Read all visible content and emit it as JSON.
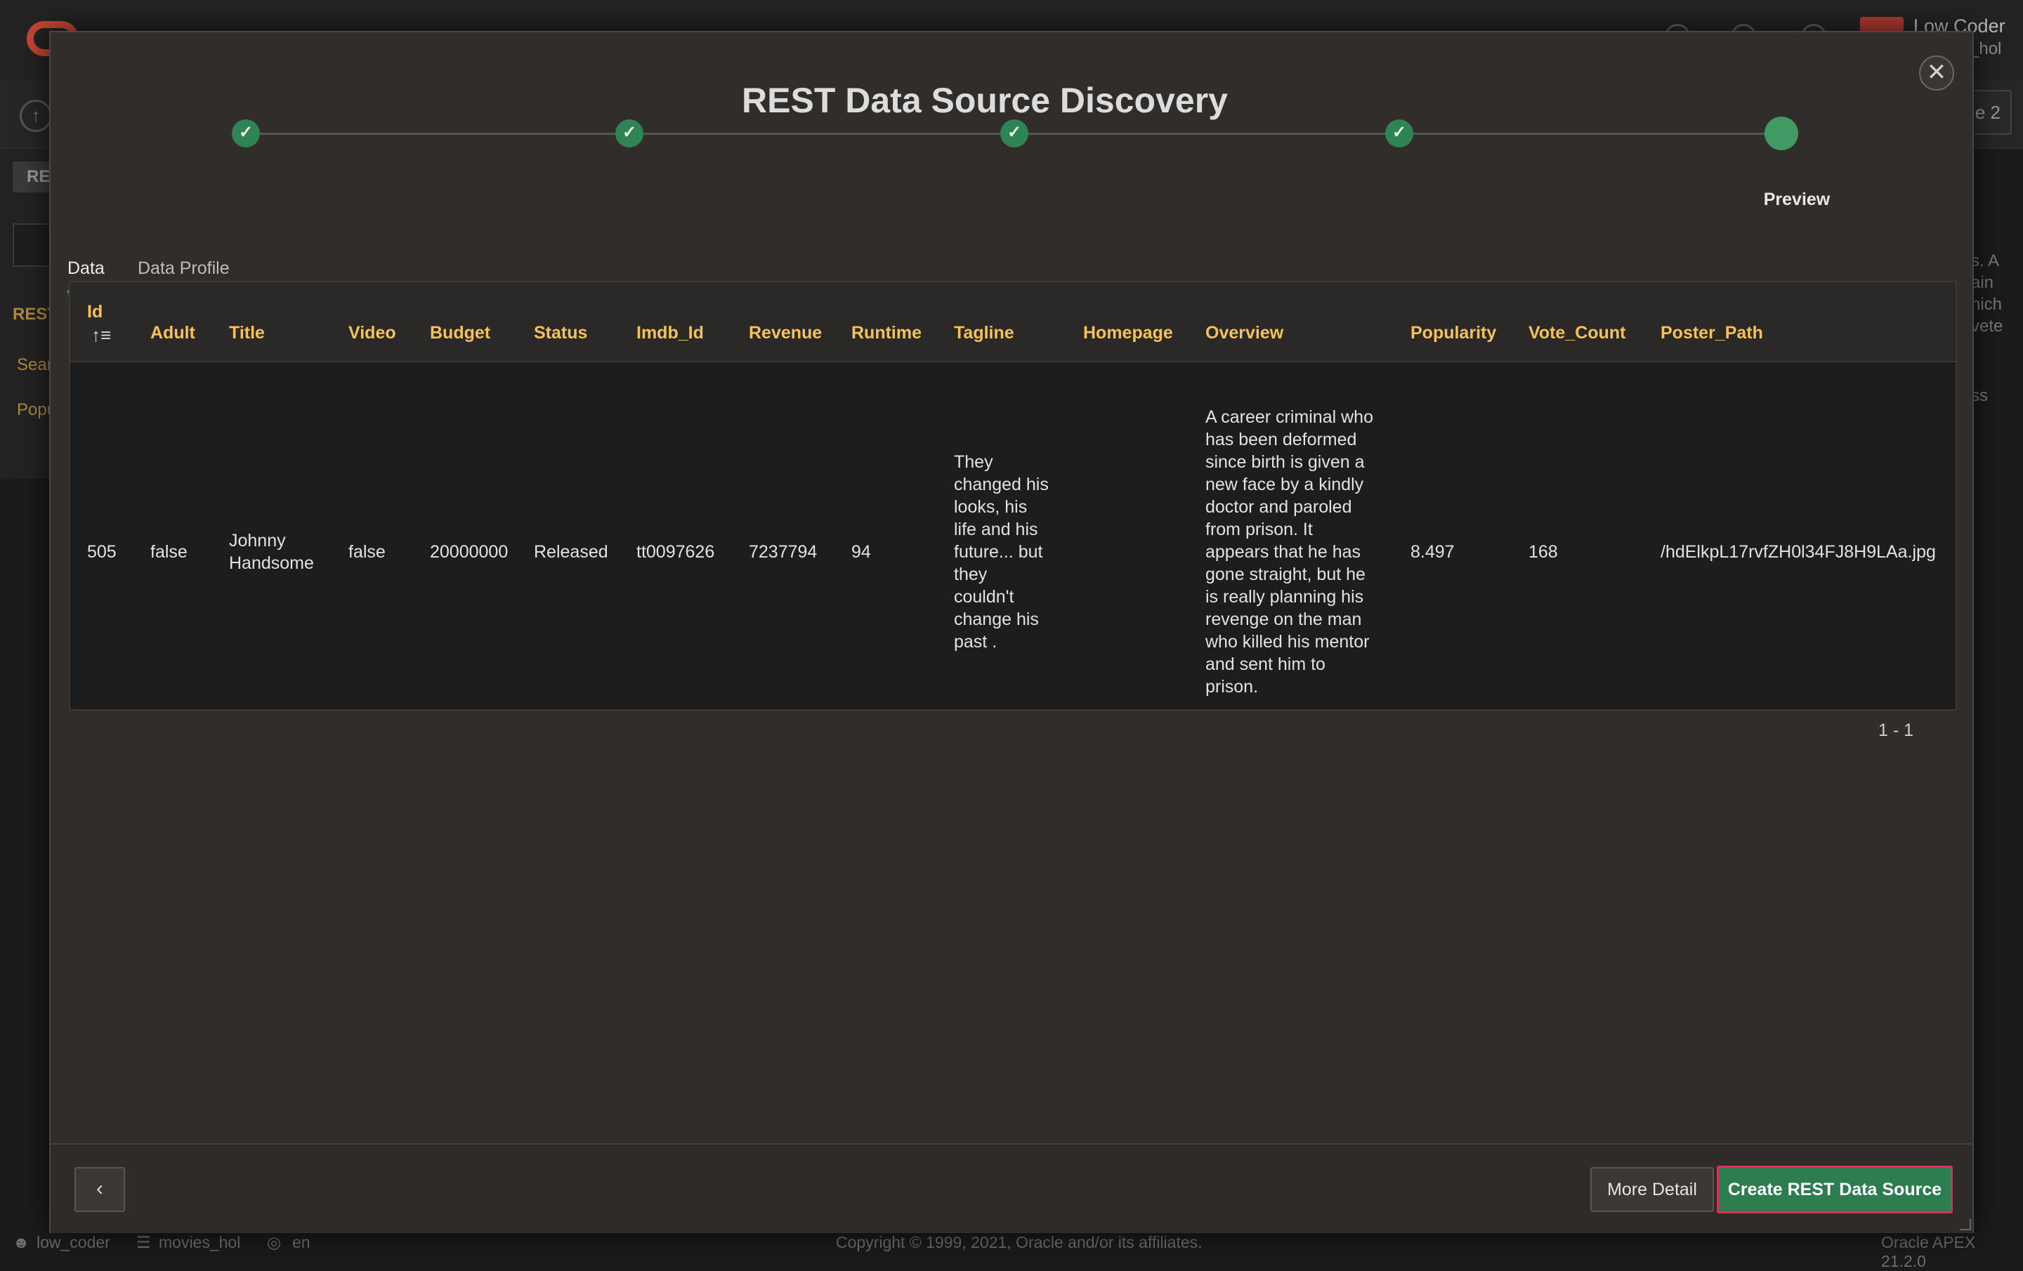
{
  "background": {
    "user_name": "Low Coder",
    "user_workspace": "_hol",
    "page_button": "e 2",
    "left_tab": "RE",
    "rest_label": "REST",
    "links": [
      "Sear",
      "Popu"
    ],
    "right_text": [
      "s. A",
      "ain",
      "hich",
      "vete",
      "ss"
    ],
    "footer": {
      "user": "low_coder",
      "schema": "movies_hol",
      "language": "en",
      "copyright": "Copyright © 1999, 2021, Oracle and/or its affiliates.",
      "version": "Oracle APEX 21.2.0"
    }
  },
  "modal": {
    "title": "REST Data Source Discovery",
    "close_glyph": "✕",
    "steps": [
      {
        "glyph": "✓"
      },
      {
        "glyph": "✓"
      },
      {
        "glyph": "✓"
      },
      {
        "glyph": "✓"
      },
      {
        "glyph": ""
      }
    ],
    "current_step_label": "Preview",
    "tabs": [
      "Data",
      "Data Profile"
    ],
    "active_tab": "Data",
    "columns": [
      "Id",
      "Adult",
      "Title",
      "Video",
      "Budget",
      "Status",
      "Imdb_Id",
      "Revenue",
      "Runtime",
      "Tagline",
      "Homepage",
      "Overview",
      "Popularity",
      "Vote_Count",
      "Poster_Path"
    ],
    "sort_glyph": "↑≡",
    "row": {
      "id": "505",
      "adult": "false",
      "title_lines": [
        "Johnny",
        "Handsome"
      ],
      "video": "false",
      "budget": "20000000",
      "status": "Released",
      "imdb_id": "tt0097626",
      "revenue": "7237794",
      "runtime": "94",
      "tagline_lines": [
        "They",
        "changed his",
        "looks, his",
        "life and his",
        "future... but",
        "they",
        "couldn't",
        "change his",
        "past ."
      ],
      "homepage": "",
      "overview_lines": [
        "A career criminal who",
        "has been deformed",
        "since birth is given a",
        "new face by a kindly",
        "doctor and paroled",
        "from prison. It",
        "appears that he has",
        "gone straight, but he",
        "is really planning his",
        "revenge on the man",
        "who killed his mentor",
        "and sent him to",
        "prison."
      ],
      "popularity": "8.497",
      "vote_count": "168",
      "poster_path": "/hdElkpL17rvfZH0l34FJ8H9LAa.jpg"
    },
    "pagination": "1 - 1",
    "buttons": {
      "back_glyph": "‹",
      "more_detail": "More Detail",
      "create": "Create REST Data Source"
    }
  }
}
